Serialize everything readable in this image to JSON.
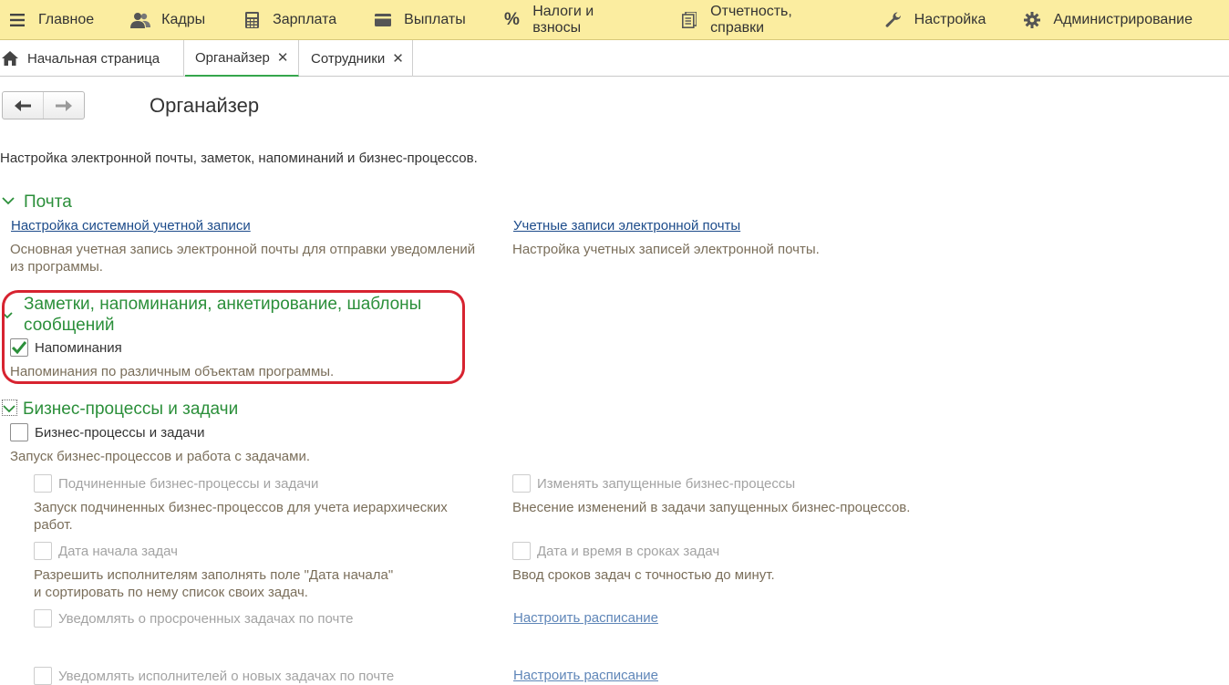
{
  "menu": [
    {
      "label": "Главное",
      "icon": "hamburger-icon"
    },
    {
      "label": "Кадры",
      "icon": "people-icon"
    },
    {
      "label": "Зарплата",
      "icon": "calculator-icon"
    },
    {
      "label": "Выплаты",
      "icon": "wallet-icon"
    },
    {
      "label": "Налоги и взносы",
      "icon": "percent-icon"
    },
    {
      "label": "Отчетность, справки",
      "icon": "reports-icon"
    },
    {
      "label": "Настройка",
      "icon": "wrench-icon"
    },
    {
      "label": "Администрирование",
      "icon": "gear-icon"
    }
  ],
  "tabs": {
    "home": "Начальная страница",
    "organizer": "Органайзер",
    "employees": "Сотрудники",
    "close_glyph": "✕"
  },
  "page": {
    "title": "Органайзер",
    "description": "Настройка электронной почты, заметок, напоминаний и бизнес-процессов."
  },
  "mail": {
    "title": "Почта",
    "system_account_link": "Настройка системной учетной записи",
    "system_account_note_1": "Основная учетная запись электронной почты для отправки уведомлений",
    "system_account_note_2": "из программы.",
    "email_accounts_link": "Учетные записи электронной почты",
    "email_accounts_note": "Настройка учетных записей электронной почты."
  },
  "notes": {
    "title_1": "Заметки, напоминания, анкетирование, шаблоны",
    "title_2": "сообщений",
    "reminders_label": "Напоминания",
    "reminders_checked": true,
    "reminders_note": "Напоминания по различным объектам программы."
  },
  "bp": {
    "title": "Бизнес-процессы и задачи",
    "main_label": "Бизнес-процессы и задачи",
    "main_checked": false,
    "main_note": "Запуск бизнес-процессов и работа с задачами.",
    "sub_label": "Подчиненные бизнес-процессы и задачи",
    "sub_note_1": "Запуск подчиненных бизнес-процессов для учета иерархических",
    "sub_note_2": "работ.",
    "change_label": "Изменять запущенные бизнес-процессы",
    "change_note": "Внесение изменений в задачи запущенных бизнес-процессов.",
    "start_date_label": "Дата начала задач",
    "start_date_note_1": "Разрешить исполнителям заполнять поле \"Дата начала\"",
    "start_date_note_2": "и сортировать по нему список своих задач.",
    "datetime_label": "Дата и время в сроках задач",
    "datetime_note": "Ввод сроков задач с точностью до минут.",
    "overdue_label": "Уведомлять о просроченных задачах по почте",
    "schedule_link_1": "Настроить расписание",
    "new_tasks_label": "Уведомлять исполнителей о новых задачах по почте",
    "schedule_link_2": "Настроить расписание"
  },
  "colors": {
    "menu_bg": "#fbeda0",
    "section_green": "#2b8f3a",
    "link_blue": "#1c4b8a",
    "highlight_red": "#d72330"
  }
}
